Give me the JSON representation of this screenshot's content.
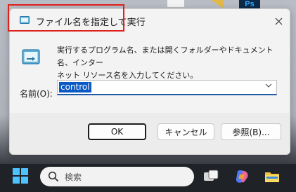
{
  "dialog": {
    "title": "ファイル名を指定して実行",
    "description_line1": "実行するプログラム名、または開くフォルダーやドキュメント名、インター",
    "description_line2": "ネット リソース名を入力してください。",
    "name_label": "名前(O):",
    "input_value": "control",
    "ok_label": "OK",
    "cancel_label": "キャンセル",
    "browse_label": "参照(B)..."
  },
  "taskbar": {
    "search_placeholder": "検索"
  },
  "desktop": {
    "ps_label": "Ps"
  },
  "colors": {
    "highlight": "#e0201b",
    "input_selection": "#0a59c4",
    "accent": "#1f5aa6"
  }
}
